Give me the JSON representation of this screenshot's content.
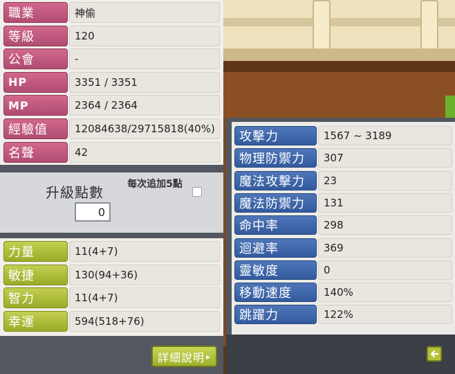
{
  "basic_stats": [
    {
      "label": "職業",
      "value": "神偷",
      "type": "cjk"
    },
    {
      "label": "等級",
      "value": "120",
      "type": "cjk"
    },
    {
      "label": "公會",
      "value": "-",
      "type": "cjk"
    },
    {
      "label": "HP",
      "value": "3351 / 3351",
      "type": "en"
    },
    {
      "label": "MP",
      "value": "2364 / 2364",
      "type": "en"
    },
    {
      "label": "經驗值",
      "value": "12084638/29715818(40%)",
      "type": "cjk"
    },
    {
      "label": "名聲",
      "value": "42",
      "type": "cjk"
    }
  ],
  "upgrade": {
    "title": "升級點數",
    "points": "0",
    "auto_label": "每次追加5點"
  },
  "ability_stats": [
    {
      "label": "力量",
      "value": "11(4+7)"
    },
    {
      "label": "敏捷",
      "value": "130(94+36)"
    },
    {
      "label": "智力",
      "value": "11(4+7)"
    },
    {
      "label": "幸運",
      "value": "594(518+76)"
    }
  ],
  "detail_button": "詳細說明",
  "detail_arrow": "▸",
  "combat_stats": [
    {
      "label": "攻擊力",
      "value": "1567 ~ 3189"
    },
    {
      "label": "物理防禦力",
      "value": "307"
    },
    {
      "label": "魔法攻擊力",
      "value": "23"
    },
    {
      "label": "魔法防禦力",
      "value": "131"
    },
    {
      "label": "命中率",
      "value": "298"
    },
    {
      "label": "迴避率",
      "value": "369"
    },
    {
      "label": "靈敏度",
      "value": "0"
    },
    {
      "label": "移動速度",
      "value": "140%"
    },
    {
      "label": "跳躍力",
      "value": "122%"
    }
  ],
  "return_icon": "return-arrow-icon",
  "colors": {
    "pink_label": "#c25a80",
    "green_label": "#afbd3c",
    "blue_label": "#4166aa",
    "panel_dark": "#525760"
  }
}
